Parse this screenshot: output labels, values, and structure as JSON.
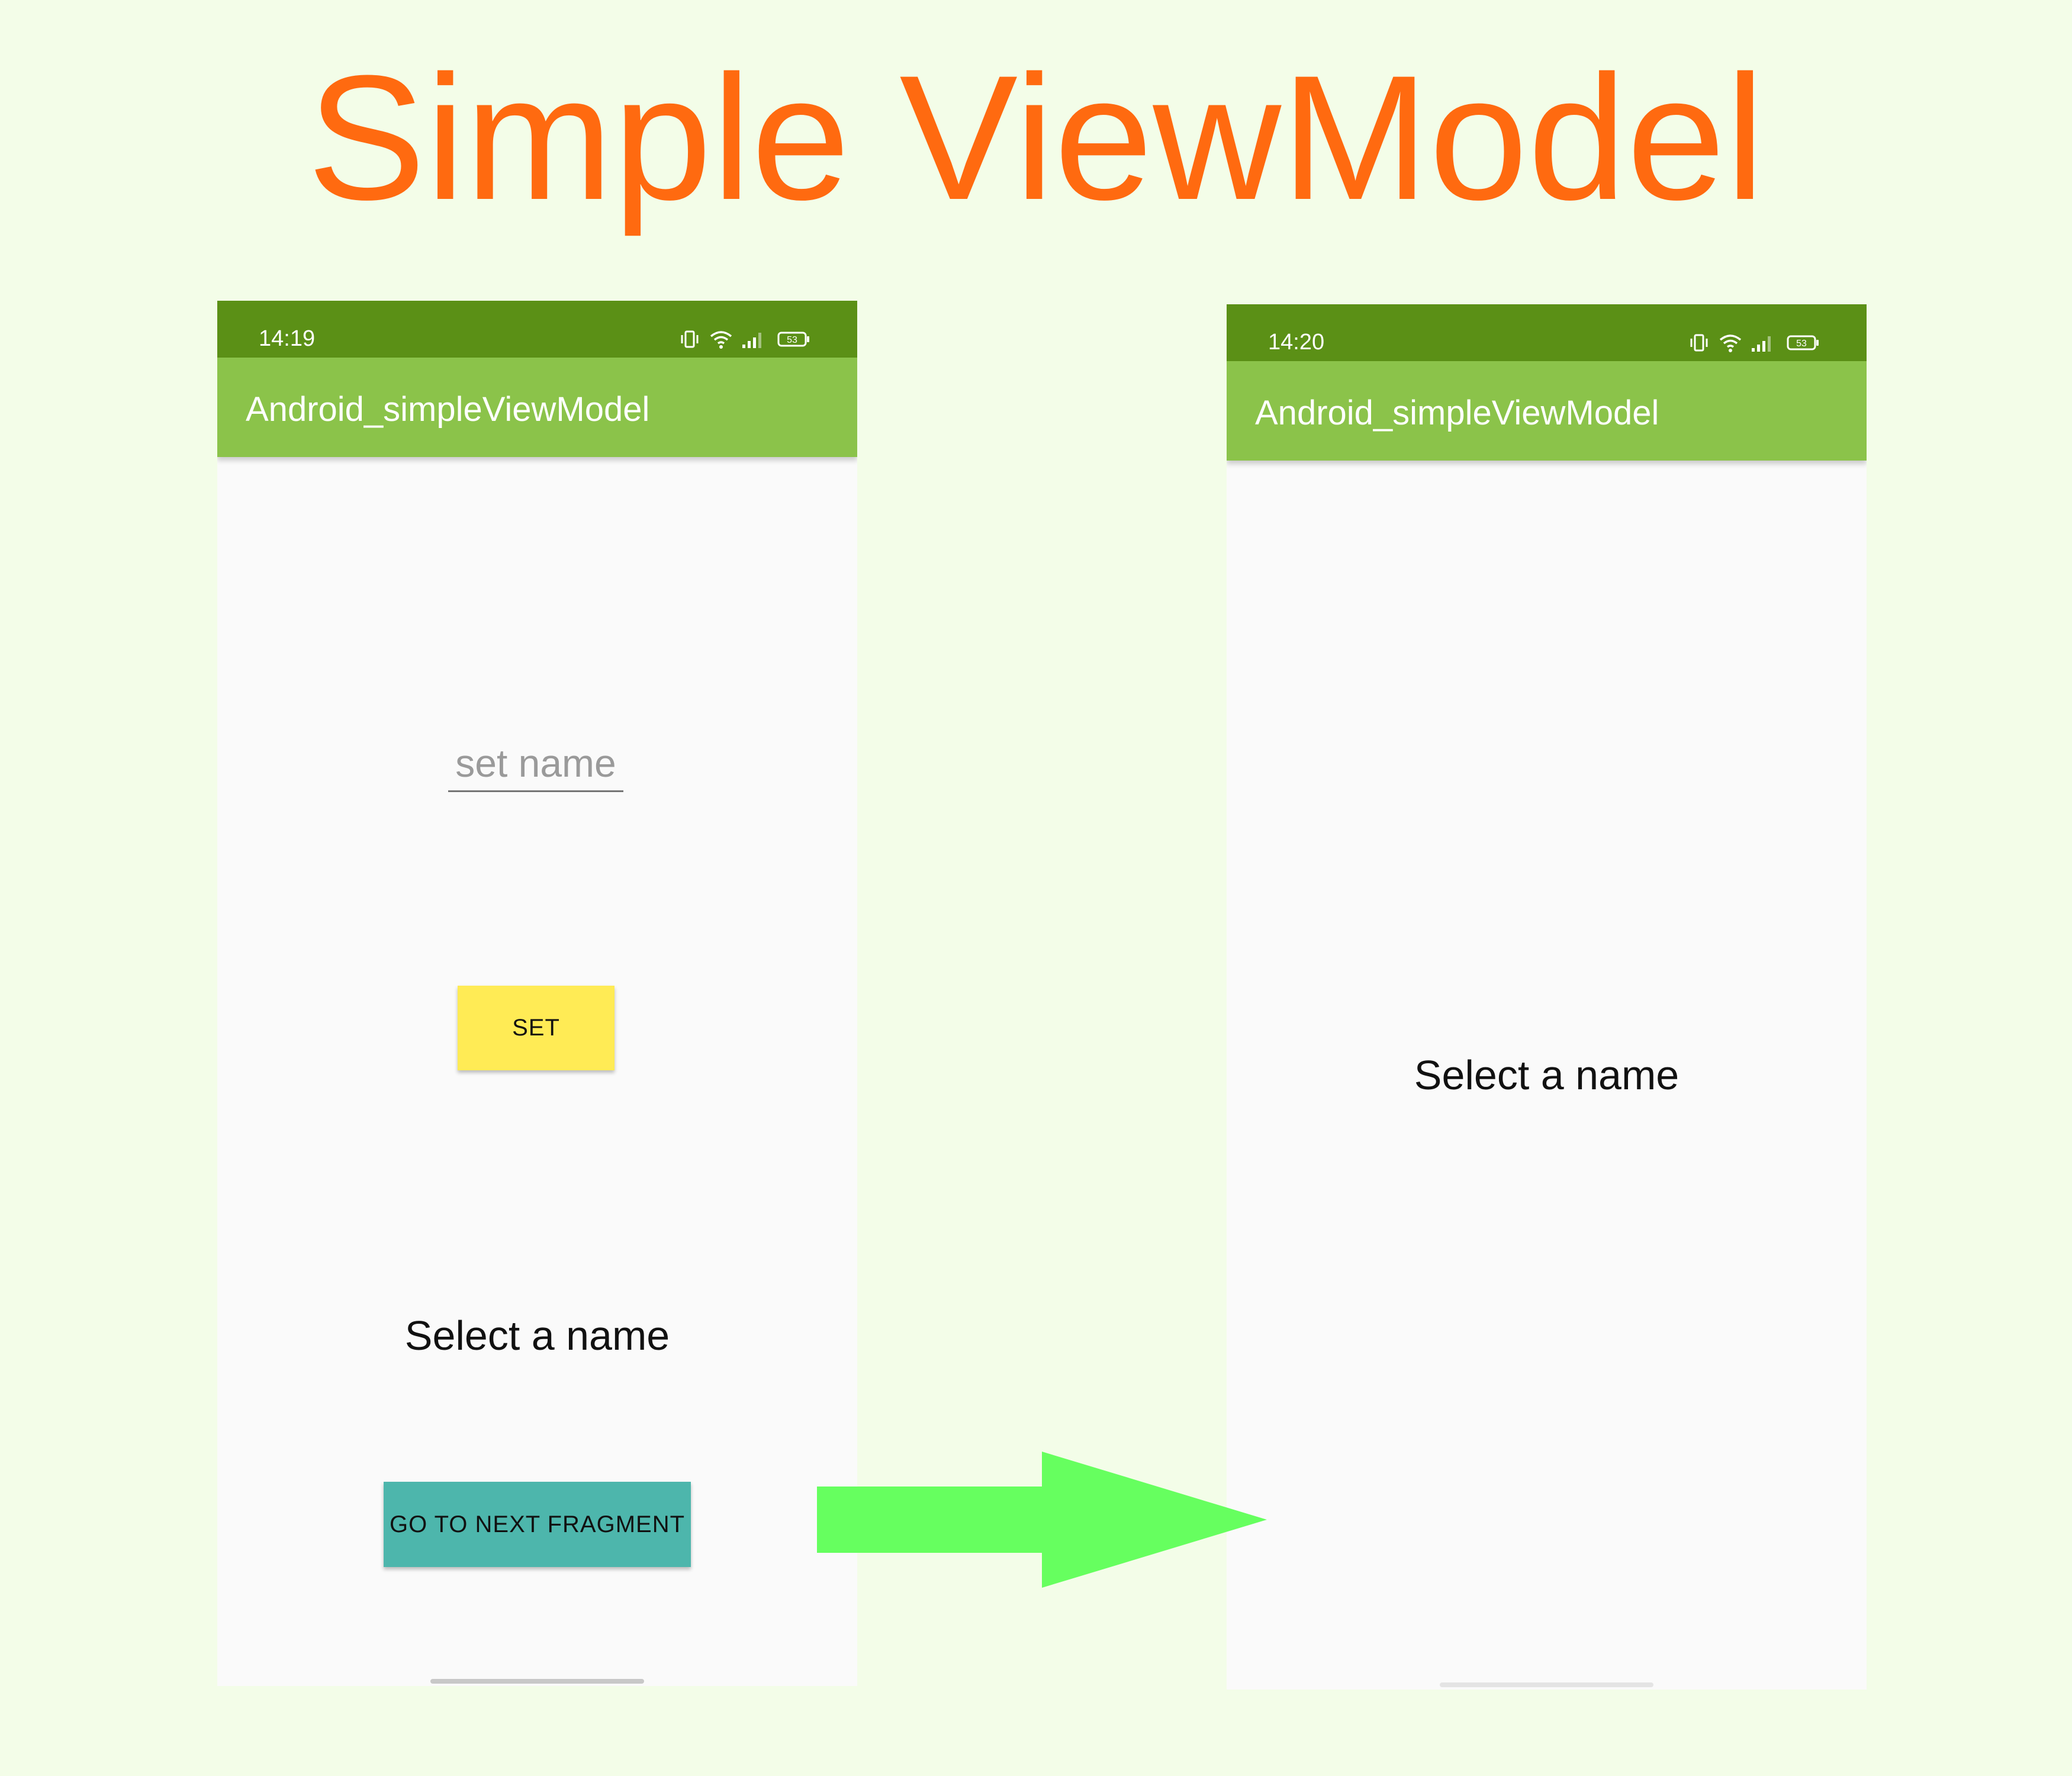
{
  "title": "Simple ViewModel",
  "colors": {
    "background": "#f3fde8",
    "title": "#ff6a10",
    "status_bar": "#5b9016",
    "app_bar": "#8bc34a",
    "set_button": "#ffeb55",
    "next_button": "#4db6ac",
    "arrow": "#66ff5f"
  },
  "left_screen": {
    "status_bar": {
      "time": "14:19",
      "battery": "53",
      "icons": [
        "vibrate-icon",
        "wifi-icon",
        "signal-icon",
        "battery-icon"
      ]
    },
    "app_bar": {
      "title": "Android_simpleViewModel"
    },
    "name_input": {
      "value": "",
      "placeholder": "set name"
    },
    "set_button": {
      "label": "SET"
    },
    "selected_name": "Select a name",
    "next_button": {
      "label": "GO TO NEXT FRAGMENT"
    }
  },
  "right_screen": {
    "status_bar": {
      "time": "14:20",
      "battery": "53",
      "icons": [
        "vibrate-icon",
        "wifi-icon",
        "signal-icon",
        "battery-icon"
      ]
    },
    "app_bar": {
      "title": "Android_simpleViewModel"
    },
    "selected_name": "Select a name"
  },
  "transition_arrow": {
    "direction": "right",
    "icon": "arrow-right-icon"
  }
}
